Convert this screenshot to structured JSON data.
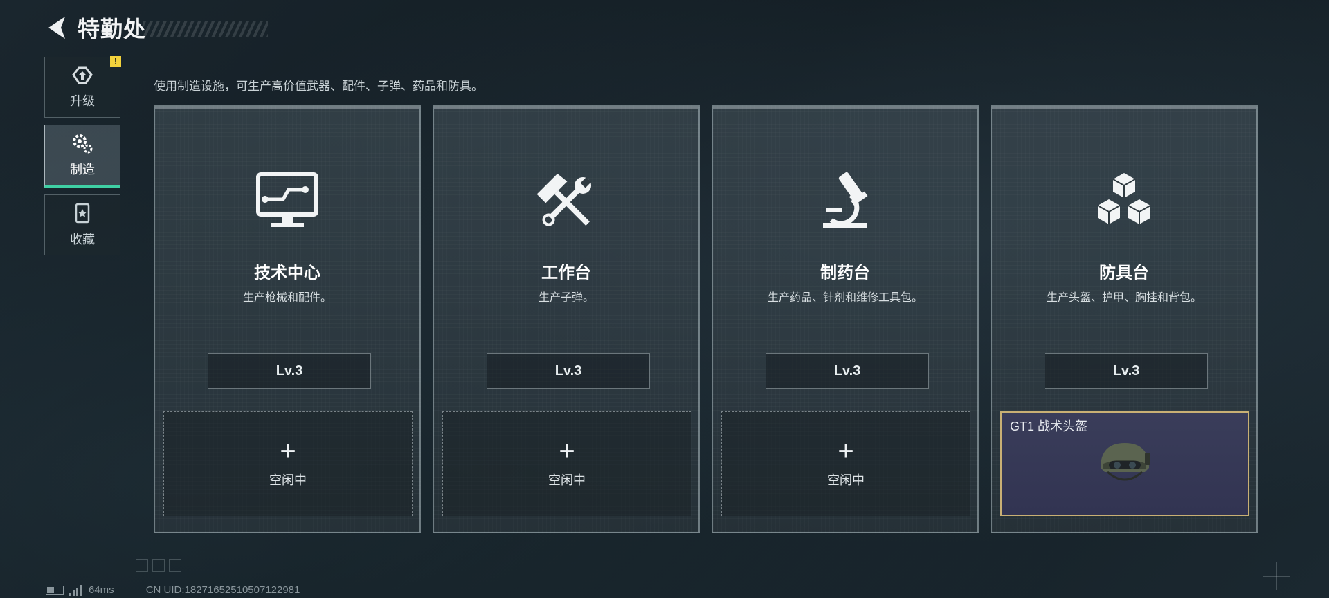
{
  "header": {
    "title": "特勤处",
    "back_icon": "back-arrow-icon"
  },
  "sidebar": {
    "items": [
      {
        "label": "升级",
        "icon": "upgrade-icon",
        "badge": "!"
      },
      {
        "label": "制造",
        "icon": "gear-icon",
        "active": true
      },
      {
        "label": "收藏",
        "icon": "collection-icon"
      }
    ]
  },
  "subtitle": "使用制造设施，可生产高价值武器、配件、子弹、药品和防具。",
  "cards": [
    {
      "name": "技术中心",
      "desc": "生产枪械和配件。",
      "level": "Lv.3",
      "icon": "computer-icon",
      "slot": {
        "plus": "+",
        "status": "空闲中"
      }
    },
    {
      "name": "工作台",
      "desc": "生产子弹。",
      "level": "Lv.3",
      "icon": "hammer-wrench-icon",
      "slot": {
        "plus": "+",
        "status": "空闲中"
      }
    },
    {
      "name": "制药台",
      "desc": "生产药品、针剂和维修工具包。",
      "level": "Lv.3",
      "icon": "microscope-icon",
      "slot": {
        "plus": "+",
        "status": "空闲中"
      }
    },
    {
      "name": "防具台",
      "desc": "生产头盔、护甲、胸挂和背包。",
      "level": "Lv.3",
      "icon": "cubes-icon",
      "slot": {
        "item": "GT1 战术头盔",
        "item_icon": "helmet-icon"
      }
    }
  ],
  "status_bar": {
    "ping": "64ms",
    "uid": "CN UID:18271652510507122981"
  },
  "colors": {
    "active_accent": "#3fd0a4",
    "warning": "#f2d23c",
    "busy_border": "#c9b074",
    "busy_bg": "#363856"
  }
}
